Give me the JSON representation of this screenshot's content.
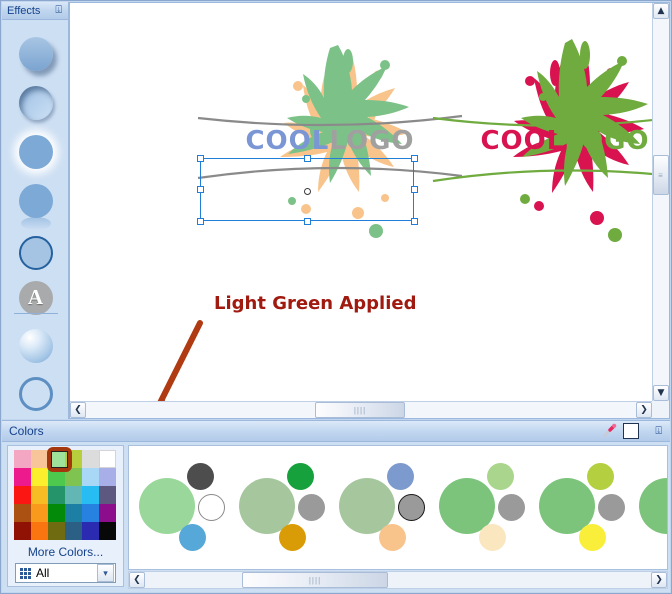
{
  "effects_panel": {
    "title": "Effects",
    "pin_icon": "pin-icon",
    "items": [
      {
        "name": "shadow-effect",
        "style": "orb-shadow",
        "label": "Shadow"
      },
      {
        "name": "inner-shadow-effect",
        "style": "orb-inner",
        "label": "Inner Shadow"
      },
      {
        "name": "glow-effect",
        "style": "orb-glow",
        "label": "Glow"
      },
      {
        "name": "reflection-effect",
        "style": "orb-reflect",
        "label": "Reflection"
      },
      {
        "name": "outline-effect",
        "style": "orb-outline",
        "label": "Outline"
      },
      {
        "name": "text-effect",
        "style": "orb-a",
        "label": "A"
      },
      {
        "name": "bevel-effect",
        "style": "orb-bevel",
        "label": "Bevel"
      },
      {
        "name": "no-fill-effect",
        "style": "orb-ring",
        "label": "No Fill"
      }
    ]
  },
  "canvas": {
    "annotation": "Light Green Applied",
    "annotation_color": "#a01a10",
    "arrow_color": "#b03a12",
    "logos": [
      {
        "name": "logo-selected",
        "word1": "COOL",
        "word2": "LOGO",
        "word1_color": "#7b96d4",
        "word2_color": "#a0a0a0",
        "splat_color_1": "#f8c48c",
        "splat_color_2": "#7cc288",
        "selected": true
      },
      {
        "name": "logo-original",
        "word1": "COOL",
        "word2": "LOGO",
        "word1_color": "#d91350",
        "word2_color": "#6fab3f",
        "splat_color_1": "#6fab3f",
        "splat_color_2": "#d91350",
        "selected": false
      }
    ],
    "scrollbars": {
      "v_up": "▲",
      "v_down": "▼",
      "h_left": "❮",
      "h_right": "❯",
      "grip": "||||"
    }
  },
  "colors_panel": {
    "title": "Colors",
    "eyedropper_icon": "eyedropper-icon",
    "white_chip_label": "white-color-chip",
    "pin_icon": "pin-icon",
    "more_colors_label": "More Colors...",
    "filter_value": "All",
    "filter_icon": "grid-icon",
    "dropdown_arrow": "▾",
    "selected_swatch_index": 2,
    "selection_ring_color": "#a5370f",
    "swatches": [
      "#f4a7c3",
      "#f8c49a",
      "#9ee29b",
      "#b8cf3d",
      "#dcdcdc",
      "#ffffff",
      "#ec1a8d",
      "#fbee2d",
      "#4ec94e",
      "#7fc450",
      "#a8d8f5",
      "#a8aee8",
      "#fb1614",
      "#f7bb23",
      "#25946b",
      "#62b7b4",
      "#27bdf2",
      "#5c5880",
      "#ab5212",
      "#f99a1c",
      "#048a09",
      "#1d7fa3",
      "#2781e0",
      "#8d0e8d",
      "#8f1205",
      "#fa7410",
      "#6f6b10",
      "#2b5f84",
      "#2a2bb0",
      "#080808"
    ],
    "themes": [
      {
        "name": "theme-1",
        "big": "#9ad79a",
        "dots": [
          "#4d4d4d",
          "#ffffff",
          "#55a8d8"
        ],
        "outlined_dot": 1
      },
      {
        "name": "theme-2",
        "big": "#a6c79e",
        "dots": [
          "#17a13c",
          "#9a9a9a",
          "#d99c06"
        ],
        "outlined_dot": -1
      },
      {
        "name": "theme-3",
        "big": "#a6c79e",
        "dots": [
          "#7d9ace",
          "#9a9a9a",
          "#f8c48c"
        ],
        "outlined_dot": 1
      },
      {
        "name": "theme-4",
        "big": "#7cc47c",
        "dots": [
          "#a9d68c",
          "#9a9a9a",
          "#fae7bf"
        ],
        "outlined_dot": -1
      },
      {
        "name": "theme-5",
        "big": "#7cc47c",
        "dots": [
          "#b4cf3f",
          "#9a9a9a",
          "#f9ee3a"
        ],
        "outlined_dot": -1
      },
      {
        "name": "theme-6",
        "big": "#7cc47c",
        "dots": [
          "#9a9a9a",
          "#9a9a9a",
          "#9a9a9a"
        ],
        "outlined_dot": -1
      }
    ],
    "scrollbar": {
      "left": "❮",
      "right": "❯",
      "grip": "||||"
    }
  }
}
